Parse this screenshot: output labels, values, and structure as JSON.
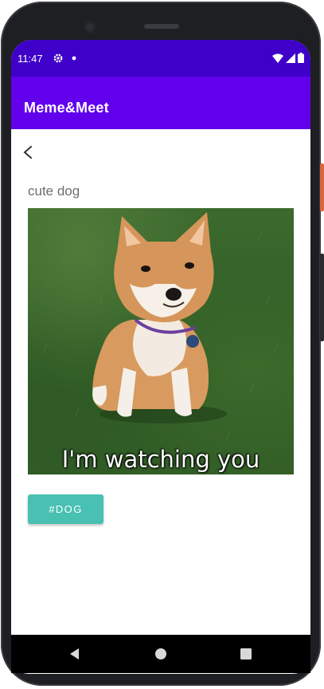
{
  "status_bar": {
    "time": "11:47",
    "icons": [
      "gear-icon",
      "notification-dot-icon",
      "wifi-icon",
      "signal-icon",
      "battery-icon"
    ]
  },
  "app_bar": {
    "title": "Meme&Meet",
    "color": "#6200ee"
  },
  "content": {
    "back_icon": "chevron-left-icon",
    "caption": "cute dog",
    "meme": {
      "subject": "shiba-inu-on-grass",
      "overlay_text": "I'm watching you"
    },
    "tag_button": {
      "label": "#DOG",
      "color": "#48c0b2"
    }
  },
  "nav_bar": {
    "buttons": [
      "back-triangle-icon",
      "home-circle-icon",
      "recents-square-icon"
    ]
  }
}
